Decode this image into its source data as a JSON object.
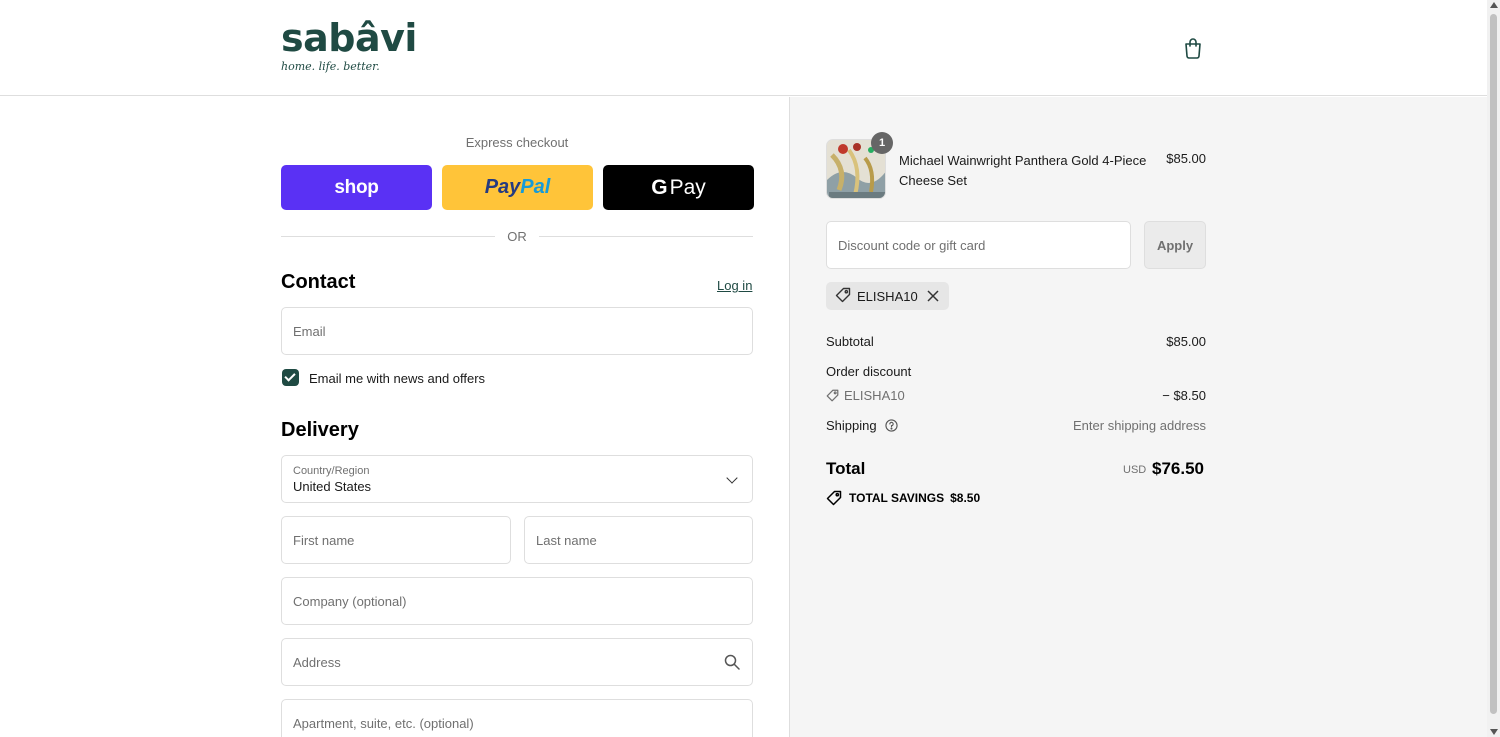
{
  "brand": {
    "name": "sabâvi",
    "tagline": "home. life. better."
  },
  "colors": {
    "brand": "#1f4a43",
    "shop": "#5a31f4",
    "paypal": "#ffc439",
    "gpay": "#000000"
  },
  "icons": {
    "cart": "shopping-bag-icon",
    "tag": "tag-icon",
    "close": "close-icon",
    "help": "question-circle-icon",
    "search": "search-icon",
    "chevron": "chevron-down-icon"
  },
  "express": {
    "label": "Express checkout",
    "shop_label": "shop",
    "paypal_label_1": "Pay",
    "paypal_label_2": "Pal",
    "gpay_g": "G",
    "gpay_label": "Pay",
    "or_label": "OR"
  },
  "contact": {
    "title": "Contact",
    "login_label": "Log in",
    "email_placeholder": "Email",
    "newsletter_label": "Email me with news and offers",
    "newsletter_checked": true
  },
  "delivery": {
    "title": "Delivery",
    "country_label": "Country/Region",
    "country_value": "United States",
    "first_name_placeholder": "First name",
    "last_name_placeholder": "Last name",
    "company_placeholder": "Company (optional)",
    "address_placeholder": "Address",
    "apartment_placeholder": "Apartment, suite, etc. (optional)"
  },
  "order": {
    "item": {
      "name": "Michael Wainwright Panthera Gold 4-Piece Cheese Set",
      "price": "$85.00",
      "quantity": "1"
    },
    "discount_placeholder": "Discount code or gift card",
    "apply_label": "Apply",
    "applied_code": "ELISHA10",
    "subtotal_label": "Subtotal",
    "subtotal_value": "$85.00",
    "order_discount_label": "Order discount",
    "discount_code": "ELISHA10",
    "discount_value": "− $8.50",
    "shipping_label": "Shipping",
    "shipping_value": "Enter shipping address",
    "total_label": "Total",
    "currency": "USD",
    "total_value": "$76.50",
    "savings_label": "TOTAL SAVINGS",
    "savings_value": "$8.50"
  }
}
